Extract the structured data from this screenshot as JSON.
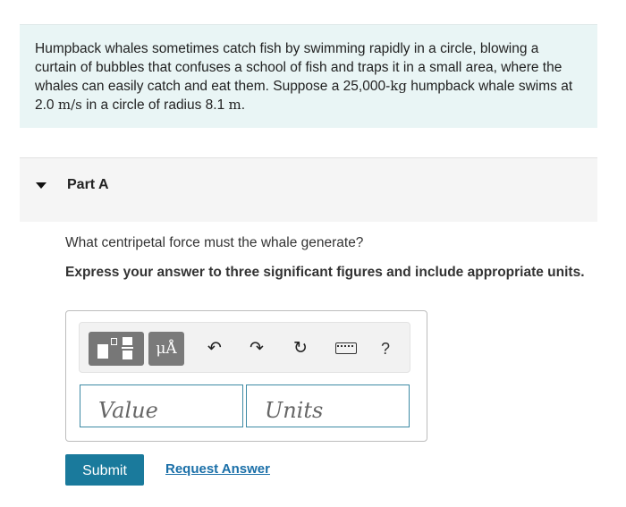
{
  "problem": {
    "text_1": "Humpback whales sometimes catch fish by swimming rapidly in a circle, blowing a curtain of bubbles that confuses a school of fish and traps it in a small area, where the whales can easily catch and eat them. Suppose a 25,000-",
    "mass_unit": "kg",
    "text_2": " humpback whale swims at 2.0 ",
    "speed_unit": "m/s",
    "text_3": " in a circle of radius 8.1 ",
    "radius_unit": "m",
    "text_4": "."
  },
  "part": {
    "title": "Part A",
    "question": "What centripetal force must the whale generate?",
    "instruction": "Express your answer to three significant figures and include appropriate units."
  },
  "toolbar": {
    "units_label": "μÅ",
    "undo_glyph": "↶",
    "redo_glyph": "↷",
    "reset_glyph": "↻",
    "help_label": "?"
  },
  "inputs": {
    "value_placeholder": "Value",
    "units_placeholder": "Units"
  },
  "actions": {
    "submit_label": "Submit",
    "request_label": "Request Answer"
  },
  "colors": {
    "problem_bg": "#e9f5f5",
    "accent": "#1a7a9c",
    "link": "#1a6fa8",
    "field_border": "#3d8aa4"
  }
}
